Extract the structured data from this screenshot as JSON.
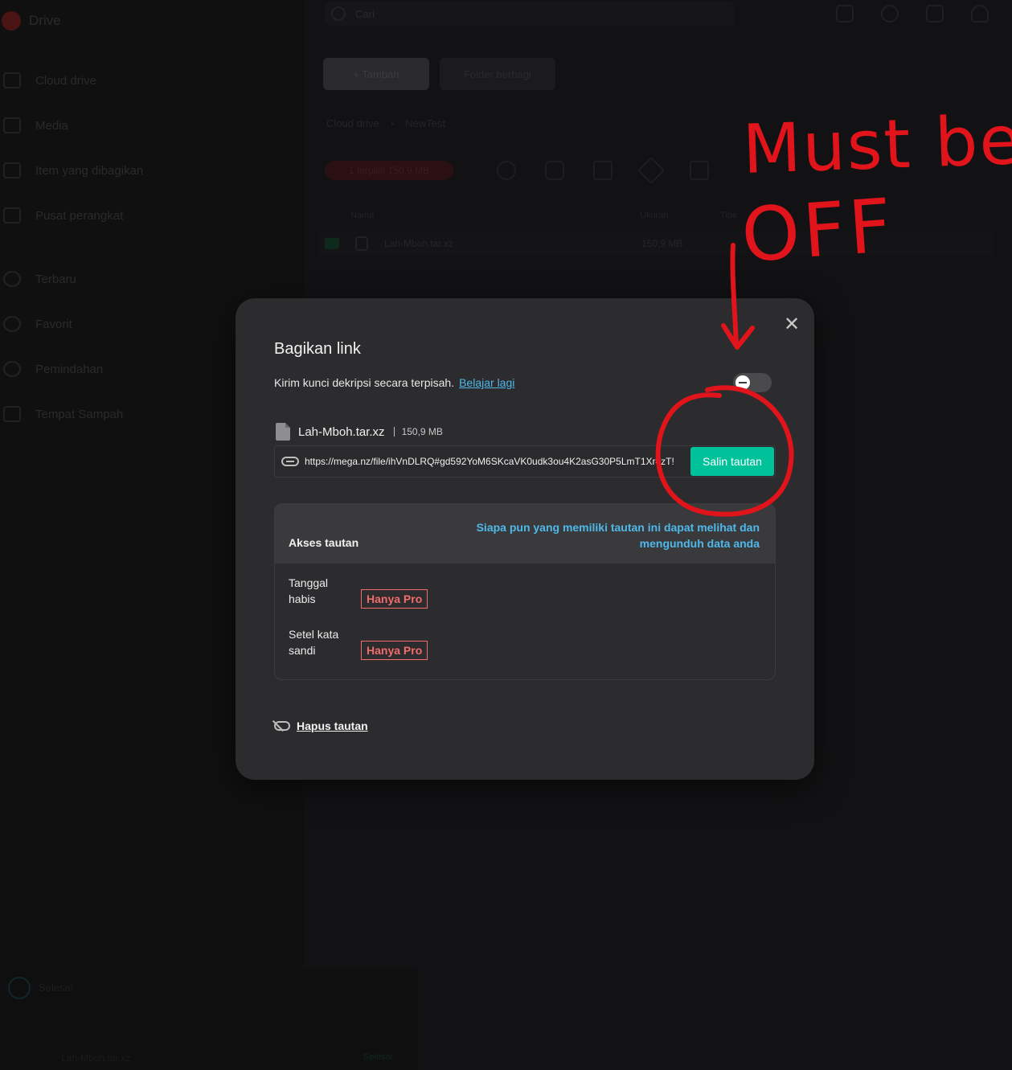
{
  "background": {
    "brand": "Drive",
    "sidebar_items": [
      "Cloud drive",
      "Media",
      "Item yang dibagikan",
      "Pusat perangkat",
      "Terbaru",
      "Favorit",
      "Pemindahan",
      "Tempat Sampah"
    ],
    "search_placeholder": "Cari",
    "buttons": {
      "add": "+ Tambah",
      "shared_folder": "Folder berbagi"
    },
    "breadcrumb": [
      "Cloud drive",
      "NewTest"
    ],
    "selected_chip": "1 terpilih  150,9 MB",
    "table_headers": [
      "Nama",
      "Ukuran",
      "Tipe"
    ],
    "file_row": {
      "name": "Lah-Mboh.tar.xz",
      "size": "150,9 MB"
    },
    "transfers": {
      "title": "Selesai",
      "file": "Lah-Mboh.tar.xz",
      "status": "Selesai"
    }
  },
  "modal": {
    "title": "Bagikan link",
    "decrypt_text": "Kirim kunci dekripsi secara terpisah.",
    "learn_more": "Belajar lagi",
    "toggle_state": "off",
    "file_name": "Lah-Mboh.tar.xz",
    "file_size": "150,9 MB",
    "link_url": "https://mega.nz/file/ihVnDLRQ#gd592YoM6SKcaVK0udk3ou4K2asG30P5LmT1Xr4zT!",
    "copy_button": "Salin tautan",
    "access_title": "Akses tautan",
    "access_note": "Siapa pun yang memiliki tautan ini dapat melihat dan mengunduh data anda",
    "options": [
      {
        "label": "Tanggal habis",
        "badge": "Hanya Pro"
      },
      {
        "label": "Setel kata sandi",
        "badge": "Hanya Pro"
      }
    ],
    "remove_link": "Hapus tautan"
  },
  "annotation": {
    "line1": "Must be",
    "line2": "OFF",
    "color": "#e0141a"
  }
}
